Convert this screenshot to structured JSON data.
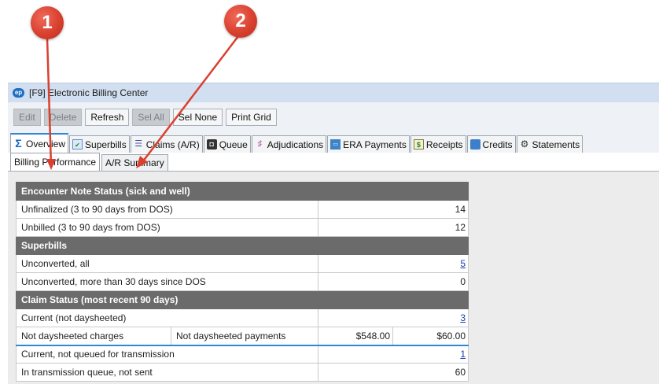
{
  "callouts": {
    "one": "1",
    "two": "2"
  },
  "window": {
    "icon_text": "ep",
    "title": "[F9] Electronic Billing Center"
  },
  "toolbar": {
    "edit": "Edit",
    "delete": "Delete",
    "refresh": "Refresh",
    "sel_all": "Sel All",
    "sel_none": "Sel None",
    "print_grid": "Print Grid"
  },
  "tabs": {
    "overview": "Overview",
    "superbills": "Superbills",
    "claims": "Claims (A/R)",
    "queue": "Queue",
    "adjudications": "Adjudications",
    "era_payments": "ERA Payments",
    "receipts": "Receipts",
    "credits": "Credits",
    "statements": "Statements"
  },
  "subtabs": {
    "billing_performance": "Billing Performance",
    "ar_summary": "A/R Summary"
  },
  "grid": {
    "encounter_header": "Encounter Note Status (sick and well)",
    "unfinalized_label": "Unfinalized (3 to 90 days from DOS)",
    "unfinalized_value": "14",
    "unbilled_label": "Unbilled (3 to 90 days from DOS)",
    "unbilled_value": "12",
    "superbills_header": "Superbills",
    "unconverted_all_label": "Unconverted, all",
    "unconverted_all_value": "5",
    "unconverted_30_label": "Unconverted, more than 30 days since DOS",
    "unconverted_30_value": "0",
    "claim_header": "Claim Status (most recent 90 days)",
    "current_label": "Current (not daysheeted)",
    "current_value": "3",
    "nds_charges_label": "Not daysheeted charges",
    "nds_payments_label": "Not daysheeted payments",
    "nds_charges_value": "$548.00",
    "nds_payments_value": "$60.00",
    "not_queued_label": "Current, not queued for transmission",
    "not_queued_value": "1",
    "in_queue_label": "In transmission queue, not sent",
    "in_queue_value": "60"
  }
}
